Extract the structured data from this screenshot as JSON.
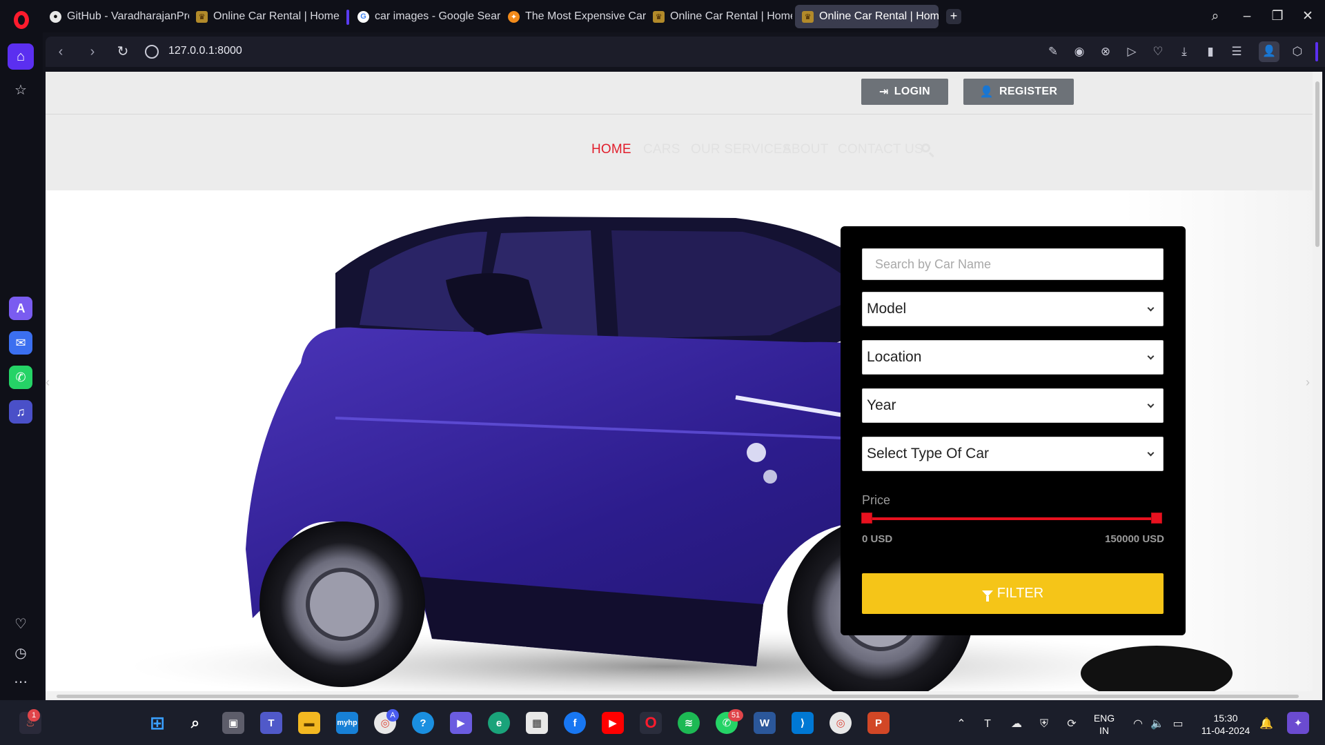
{
  "browser": {
    "tabs": [
      {
        "title": "GitHub - VaradharajanProj",
        "icon": "github-icon"
      },
      {
        "title": "Online Car Rental | Home",
        "icon": "crest-icon"
      },
      {
        "title": "car images - Google Searc",
        "icon": "google-icon"
      },
      {
        "title": "The Most Expensive Car In",
        "icon": "chip-icon"
      },
      {
        "title": "Online Car Rental | Home",
        "icon": "crest-icon"
      },
      {
        "title": "Online Car Rental | Home",
        "icon": "crest-icon",
        "active": true
      }
    ],
    "new_tab": "+",
    "url": "127.0.0.1:8000"
  },
  "site": {
    "auth": {
      "login_label": "LOGIN",
      "register_label": "REGISTER"
    },
    "menu": {
      "home": "HOME",
      "cars": "CARS",
      "services": "OUR SERVICES",
      "about": "ABOUT",
      "contact": "CONTACT US"
    },
    "colors": {
      "active_menu": "#e11d2b",
      "filter_button": "#f5c518",
      "price_slider": "#e8111f"
    },
    "filter": {
      "search_placeholder": "Search by Car Name",
      "model": "Model",
      "location": "Location",
      "year": "Year",
      "type": "Select Type Of Car",
      "price_label": "Price",
      "price_min": "0 USD",
      "price_max": "150000 USD",
      "price_range_fraction": [
        0,
        1
      ],
      "button_label": "FILTER"
    }
  },
  "taskbar": {
    "badges": {
      "chrome": "A",
      "whatsapp": "51",
      "notification": "1"
    },
    "lang_top": "ENG",
    "lang_bottom": "IN",
    "time": "15:30",
    "date": "11-04-2024"
  }
}
